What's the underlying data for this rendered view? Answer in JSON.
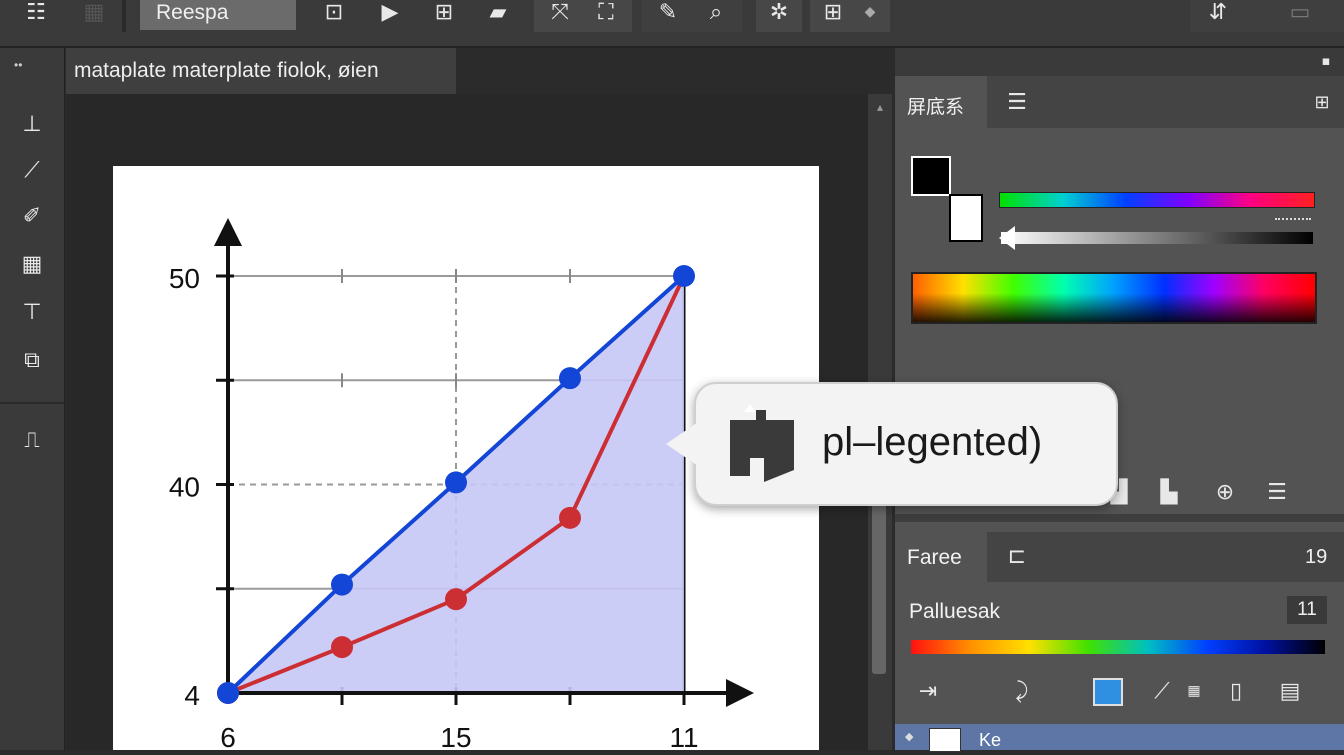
{
  "toolbar": {
    "preset_value": "Reespa",
    "icons": [
      "menu-icon",
      "frame-icon",
      "play-icon",
      "grid-icon",
      "layer-icon",
      "transform-icon",
      "crop-icon",
      "pen-icon",
      "zoom-icon",
      "settings-icon",
      "layout-icon",
      "more-icon",
      "share-icon",
      "panel-icon"
    ]
  },
  "left_strip": {
    "collapse_label": "••"
  },
  "document": {
    "tab_title": "mataplate materplate fiolok, øien"
  },
  "right_panel": {
    "color_tab_label": "屏底系",
    "layers_tab_label": "Faree",
    "layers_count": "19",
    "palette_label": "Palluesak",
    "palette_value": "11"
  },
  "callout": {
    "text": "pl–legented)"
  },
  "colors": {
    "blue_series": "#1346d6",
    "red_series": "#cc2f33",
    "fill": "#c6c8f6"
  },
  "chart_data": {
    "type": "line",
    "x": [
      6,
      10.5,
      15,
      19.5,
      24
    ],
    "x_tick_labels": [
      {
        "x": 6,
        "label": "6"
      },
      {
        "x": 15,
        "label": "15"
      },
      {
        "x": 24,
        "label": "11"
      }
    ],
    "y_tick_labels": [
      {
        "y": 50,
        "label": "50"
      },
      {
        "y": 40,
        "label": "40"
      },
      {
        "y": 30,
        "label": "4"
      }
    ],
    "ylim": [
      30,
      50
    ],
    "xlim": [
      6,
      24
    ],
    "series": [
      {
        "values": [
          30,
          35.2,
          40.1,
          45.1,
          50
        ]
      },
      {
        "values": [
          30,
          32.2,
          34.5,
          38.4,
          50
        ]
      }
    ],
    "area_fill": "between series, below blue",
    "grid": true
  }
}
